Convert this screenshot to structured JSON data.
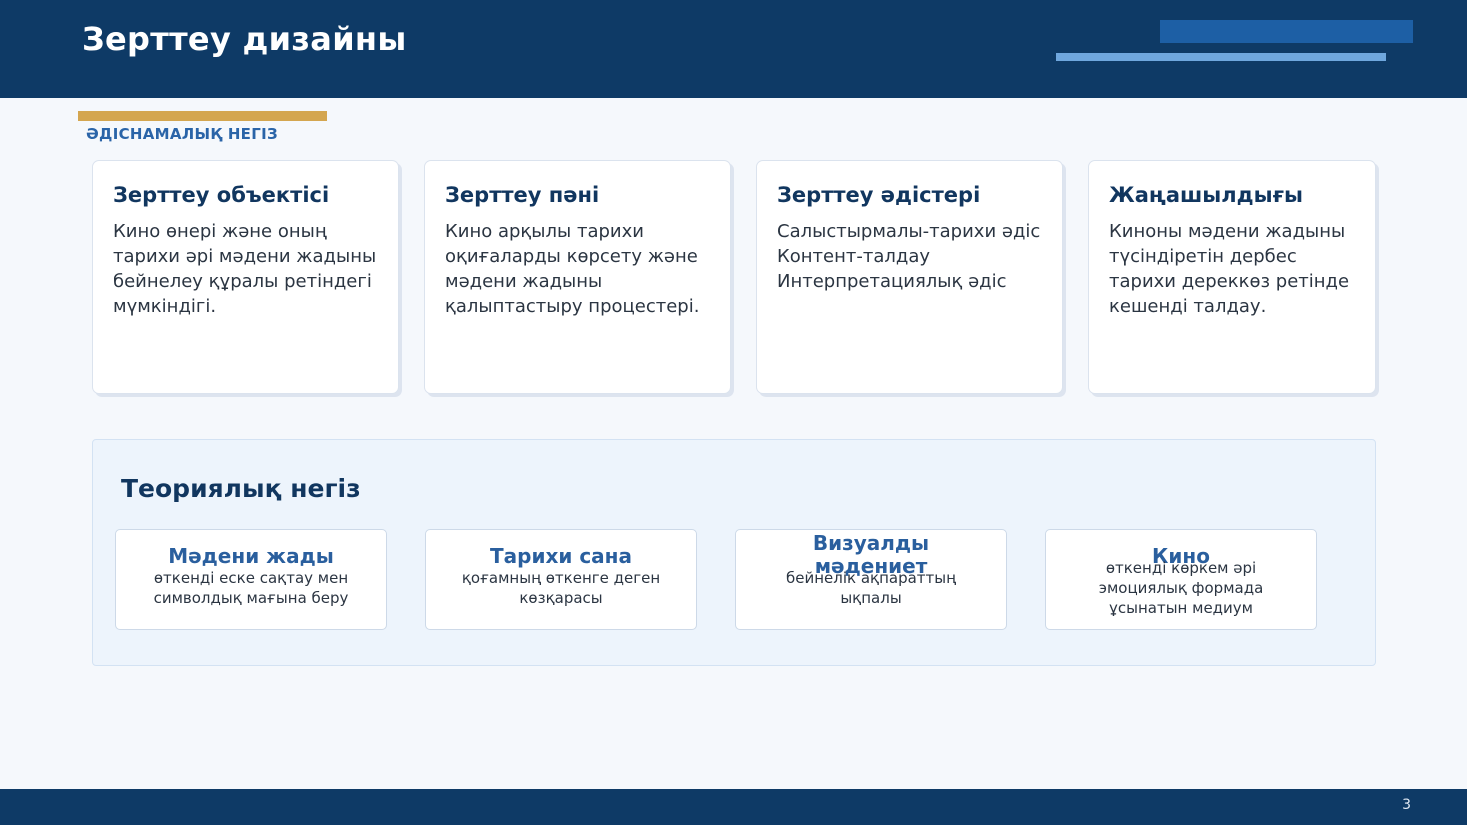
{
  "header": {
    "title": "Зерттеу дизайны"
  },
  "section_label": "ӘДІСНАМАЛЫҚ НЕГІЗ",
  "cards": [
    {
      "title": "Зерттеу объектісі",
      "text": "Кино өнері және оның тарихи әрі мәдени жадыны бейнелеу құралы ретіндегі мүмкіндігі."
    },
    {
      "title": "Зерттеу пәні",
      "text": "Кино арқылы тарихи оқиғаларды көрсету және мәдени жадыны қалыптастыру процестері."
    },
    {
      "title": "Зерттеу әдістері",
      "lines": [
        "Салыстырмалы-тарихи әдіс",
        "Контент-талдау",
        "Интерпретациялық әдіс"
      ]
    },
    {
      "title": "Жаңашылдығы",
      "text": "Киноны мәдени жадыны түсіндіретін дербес тарихи дереккөз ретінде кешенді талдау."
    }
  ],
  "theory": {
    "title": "Теориялық негіз",
    "items": [
      {
        "title": "Мәдени жады",
        "text": "өткенді еске сақтау мен символдық мағына беру"
      },
      {
        "title": "Тарихи сана",
        "text": "қоғамның өткенге деген көзқарасы"
      },
      {
        "title": "Визуалды мәдениет",
        "text": "бейнелік ақпараттың ықпалы"
      },
      {
        "title": "Кино",
        "text": "өткенді көркем әрі эмоциялық формада ұсынатын медиум"
      }
    ]
  },
  "footer": {
    "page_number": "3"
  },
  "colors": {
    "primary_navy": "#0e3a66",
    "accent_gold": "#d4a650",
    "accent_blue": "#1d5fa5",
    "light_blue": "#6fa7de"
  }
}
